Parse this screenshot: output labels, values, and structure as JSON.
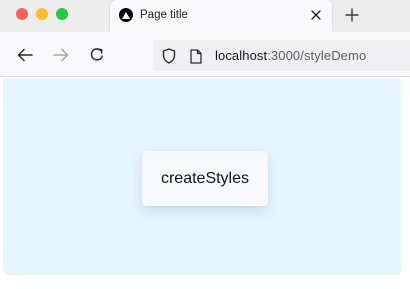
{
  "window": {
    "controls": {
      "close_color": "#ff5f57",
      "minimize_color": "#febc2e",
      "maximize_color": "#28c840"
    }
  },
  "tab": {
    "title": "Page title",
    "favicon": "nextjs-triangle-icon",
    "close_icon": "close-icon"
  },
  "newtab_icon": "plus-icon",
  "nav": {
    "back_icon": "arrow-left-icon",
    "forward_icon": "arrow-right-icon",
    "reload_icon": "reload-icon"
  },
  "urlbar": {
    "security_icon": "shield-icon",
    "page_icon": "page-icon",
    "host": "localhost",
    "rest": ":3000/styleDemo"
  },
  "content": {
    "background_color": "#e7f5ff",
    "button": {
      "label": "createStyles",
      "background_color": "#f8f9fa"
    }
  }
}
